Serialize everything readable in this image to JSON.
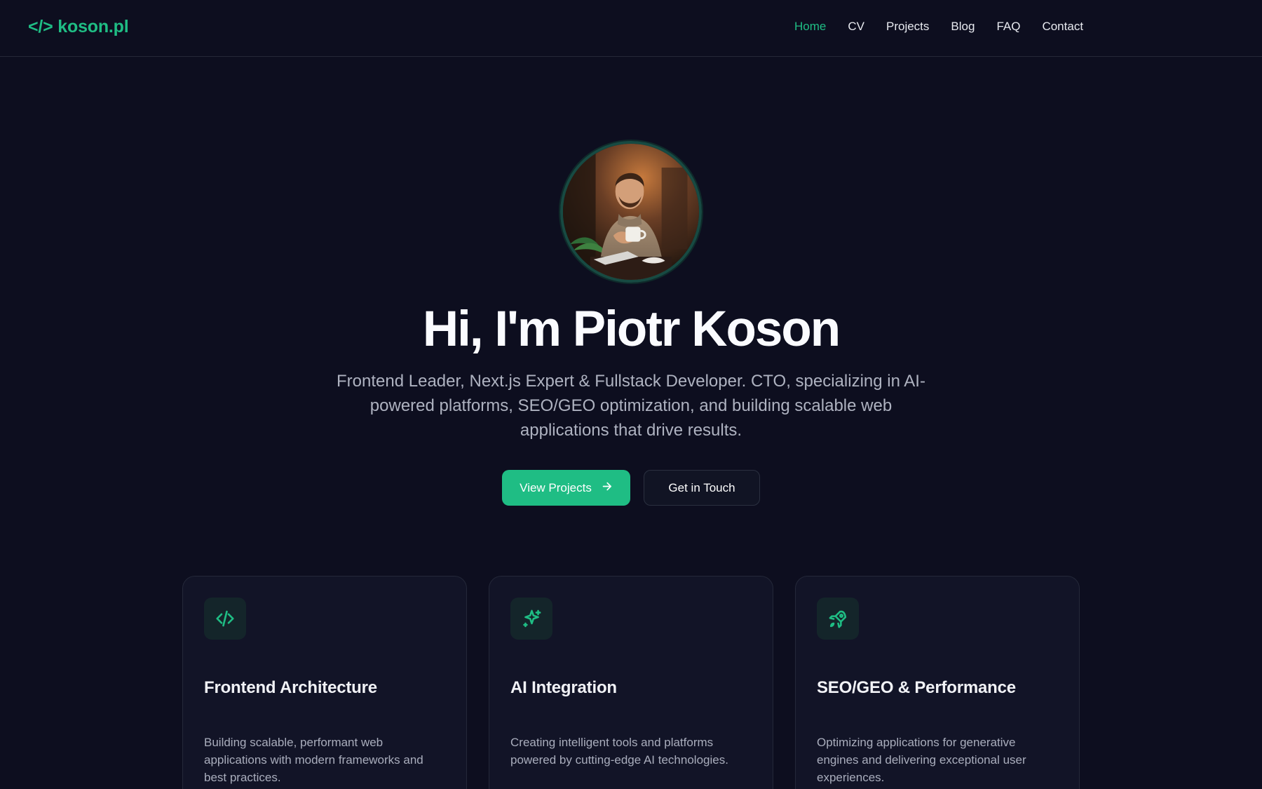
{
  "header": {
    "logo": "</> koson.pl",
    "nav": [
      {
        "label": "Home",
        "active": true
      },
      {
        "label": "CV",
        "active": false
      },
      {
        "label": "Projects",
        "active": false
      },
      {
        "label": "Blog",
        "active": false
      },
      {
        "label": "FAQ",
        "active": false
      },
      {
        "label": "Contact",
        "active": false
      }
    ]
  },
  "hero": {
    "avatar_alt": "avatar",
    "title": "Hi, I'm Piotr Koson",
    "subtitle": "Frontend Leader, Next.js Expert & Fullstack Developer. CTO, specializing in AI-powered platforms, SEO/GEO optimization, and building scalable web applications that drive results.",
    "primary_button": "View Projects",
    "secondary_button": "Get in Touch"
  },
  "cards": [
    {
      "icon": "code-icon",
      "title": "Frontend Architecture",
      "text": "Building scalable, performant web applications with modern frameworks and best practices."
    },
    {
      "icon": "sparkles-icon",
      "title": "AI Integration",
      "text": "Creating intelligent tools and platforms powered by cutting-edge AI technologies."
    },
    {
      "icon": "rocket-icon",
      "title": "SEO/GEO & Performance",
      "text": "Optimizing applications for generative engines and delivering exceptional user experiences."
    }
  ],
  "colors": {
    "background": "#0d0e1f",
    "accent": "#1fbd84",
    "card": "#121427",
    "muted_text": "#aeb2c0"
  }
}
